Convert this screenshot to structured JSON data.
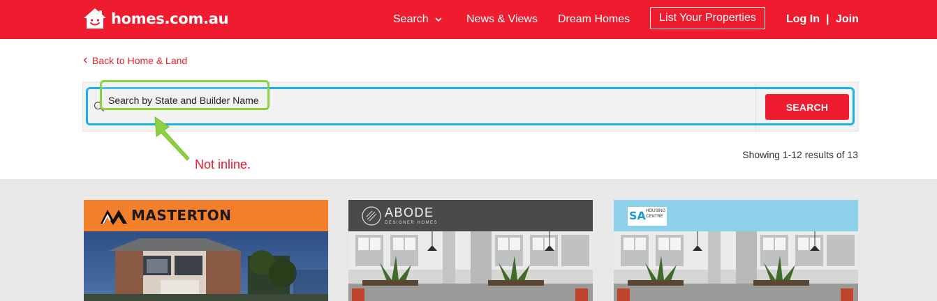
{
  "header": {
    "brand": "homes.com.au",
    "nav": {
      "search": "Search",
      "news": "News & Views",
      "dream": "Dream Homes",
      "list": "List Your Properties",
      "login": "Log In",
      "separator": "|",
      "join": "Join"
    }
  },
  "back_link": "Back to Home & Land",
  "search": {
    "placeholder": "Search by State and Builder Name",
    "button": "SEARCH"
  },
  "annotation": {
    "note": "Not inline."
  },
  "results": {
    "count_text": "Showing 1-12 results of 13"
  },
  "cards": [
    {
      "brand": "MASTERTON",
      "header_color": "#f47f2a"
    },
    {
      "brand": "ABODE",
      "tagline": "DESIGNER HOMES",
      "header_color": "#4a4a4a"
    },
    {
      "brand": "SA",
      "tagline_line1": "HOUSING",
      "tagline_line2": "CENTRE",
      "header_color": "#8dd0ea"
    }
  ],
  "colors": {
    "brand_red": "#ee1c2e",
    "annotation_blue": "#1ab1e8",
    "annotation_green": "#8cd13f"
  },
  "icons": [
    "house-logo-icon",
    "chevron-down-icon",
    "chevron-left-icon",
    "search-icon",
    "annotation-arrow-icon"
  ]
}
